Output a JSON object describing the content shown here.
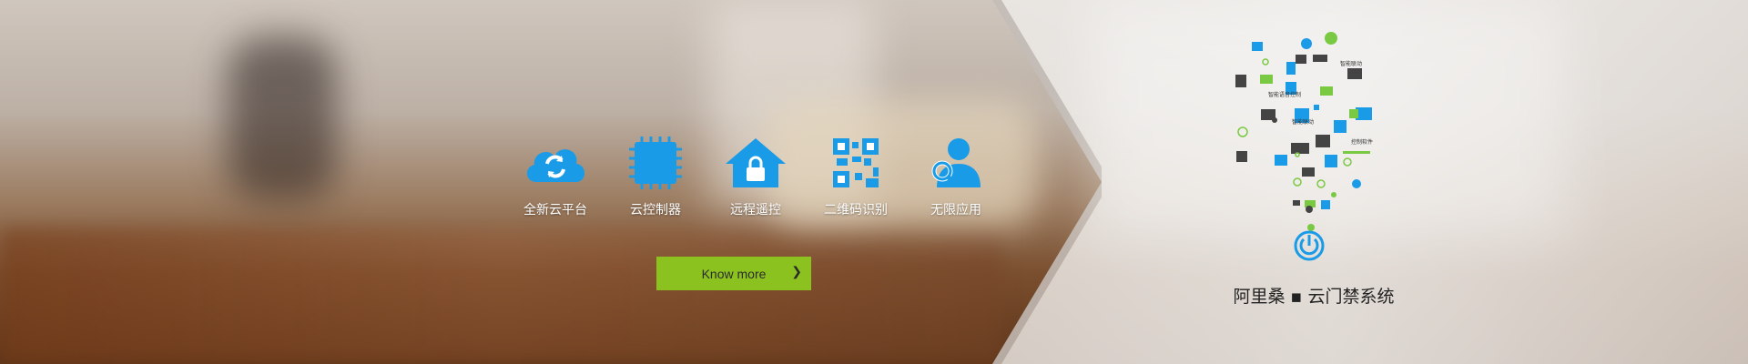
{
  "features": [
    {
      "label": "全新云平台",
      "icon": "cloud-sync-icon"
    },
    {
      "label": "云控制器",
      "icon": "chip-icon"
    },
    {
      "label": "远程遥控",
      "icon": "home-lock-icon"
    },
    {
      "label": "二维码识别",
      "icon": "qr-code-icon"
    },
    {
      "label": "无限应用",
      "icon": "user-search-icon"
    }
  ],
  "cta": {
    "label": "Know more",
    "chevron": "❯"
  },
  "system": {
    "title": "阿里桑 ▪ 云门禁系统",
    "icon": "power-icon"
  },
  "iot_labels": [
    "智能联动",
    "智能语音控制",
    "智能联动",
    "控制软件"
  ],
  "colors": {
    "icon_blue": "#1a9be8",
    "cta_green": "#8cc21f",
    "accent_green": "#7ac943"
  }
}
